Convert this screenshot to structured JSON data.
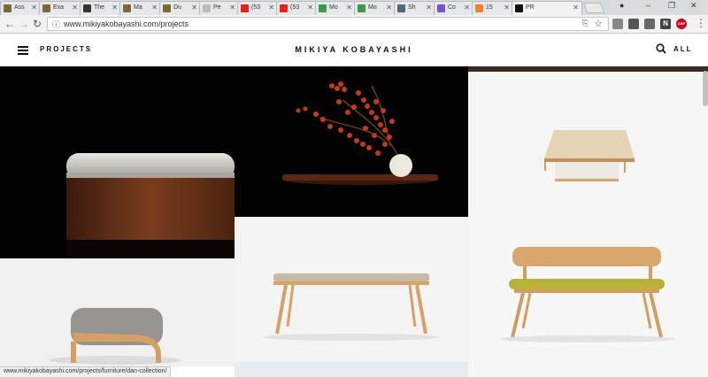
{
  "browser": {
    "tabs": [
      {
        "title": "Ass",
        "favicon_color": "#7a6a3a"
      },
      {
        "title": "Exa",
        "favicon_color": "#7a6a3a"
      },
      {
        "title": "The",
        "favicon_color": "#333333"
      },
      {
        "title": "Ma",
        "favicon_color": "#7a6a3a"
      },
      {
        "title": "Du",
        "favicon_color": "#7a6a3a"
      },
      {
        "title": "Pe",
        "favicon_color": "#bbbbbb"
      },
      {
        "title": "(53",
        "favicon_color": "#e62117"
      },
      {
        "title": "(53",
        "favicon_color": "#e62117"
      },
      {
        "title": "Mo",
        "favicon_color": "#3a9a4a"
      },
      {
        "title": "Mo",
        "favicon_color": "#3a9a4a"
      },
      {
        "title": "Sh",
        "favicon_color": "#556677"
      },
      {
        "title": "Co",
        "favicon_color": "#7a55c8"
      },
      {
        "title": "15",
        "favicon_color": "#f08030"
      },
      {
        "title": "PR",
        "favicon_color": "#111111"
      }
    ],
    "url": "www.mikiyakobayashi.com/projects",
    "status_url": "www.mikiyakobayashi.com/projects/furniture/dan-collection/",
    "extensions": [
      {
        "label": "",
        "color": "#888888"
      },
      {
        "label": "",
        "color": "#555555"
      },
      {
        "label": "",
        "color": "#666666"
      },
      {
        "label": "N",
        "color": "#444444"
      },
      {
        "label": "ABP",
        "color": "#d0021b"
      }
    ]
  },
  "site": {
    "menu_label": "PROJECTS",
    "brand": "MIKIYA KOBAYASHI",
    "filter_label": "ALL"
  }
}
